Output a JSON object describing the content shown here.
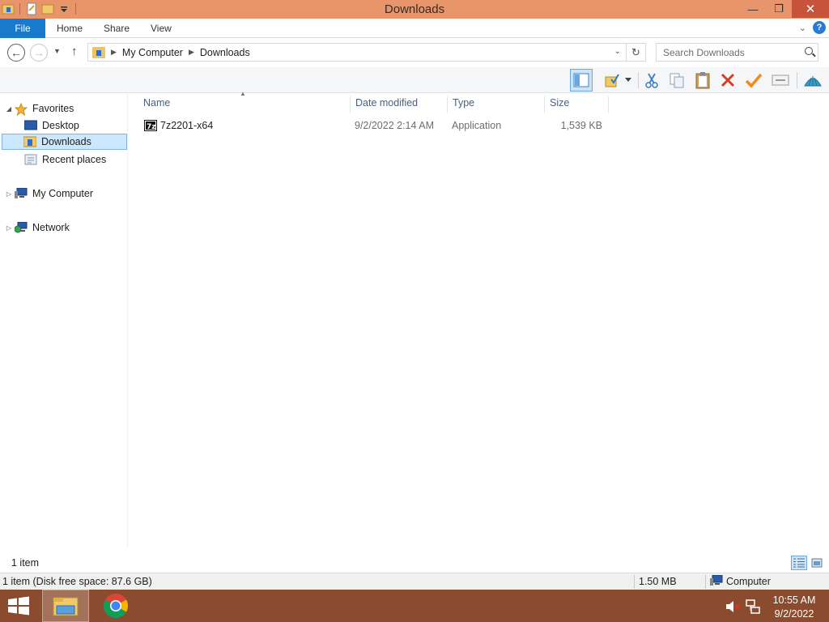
{
  "window": {
    "title": "Downloads"
  },
  "ribbon": {
    "tabs": [
      "File",
      "Home",
      "Share",
      "View"
    ]
  },
  "address": {
    "crumbs": [
      "My Computer",
      "Downloads"
    ],
    "search_placeholder": "Search Downloads"
  },
  "toolbar": {
    "buttons": [
      "preview-pane-icon",
      "folder-options-icon",
      "cut-icon",
      "copy-icon",
      "paste-icon",
      "delete-icon",
      "check-icon",
      "rename-icon",
      "shell-icon"
    ]
  },
  "nav_pane": {
    "favorites_label": "Favorites",
    "favorites": [
      "Desktop",
      "Downloads",
      "Recent places"
    ],
    "selected": "Downloads",
    "my_computer": "My Computer",
    "network": "Network"
  },
  "columns": [
    "Name",
    "Date modified",
    "Type",
    "Size"
  ],
  "files": [
    {
      "name": "7z2201-x64",
      "date": "9/2/2022 2:14 AM",
      "type": "Application",
      "size": "1,539 KB"
    }
  ],
  "status": {
    "item_count": "1 item",
    "details": "1 item (Disk free space: 87.6 GB)",
    "size": "1.50 MB",
    "location": "Computer"
  },
  "taskbar": {
    "time": "10:55 AM",
    "date": "9/2/2022"
  },
  "colors": {
    "titlebar": "#e8956c",
    "file_tab": "#1979ca",
    "taskbar": "#8a4b2e",
    "selection": "#cce8ff"
  }
}
